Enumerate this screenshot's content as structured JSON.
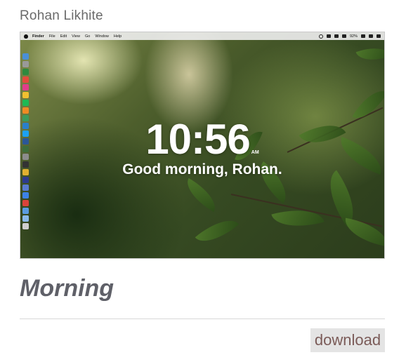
{
  "author": "Rohan Likhite",
  "screenshot": {
    "menubar": {
      "items": [
        "Finder",
        "File",
        "Edit",
        "View",
        "Go",
        "Window",
        "Help"
      ],
      "battery": "92%"
    },
    "clock": {
      "time": "10:56",
      "ampm": "AM",
      "greeting": "Good morning, Rohan."
    }
  },
  "title": "Morning",
  "download_label": "download",
  "colors": {
    "download_text": "#7b5b58",
    "download_bg": "#e4e4e4",
    "title": "#5f6068"
  }
}
